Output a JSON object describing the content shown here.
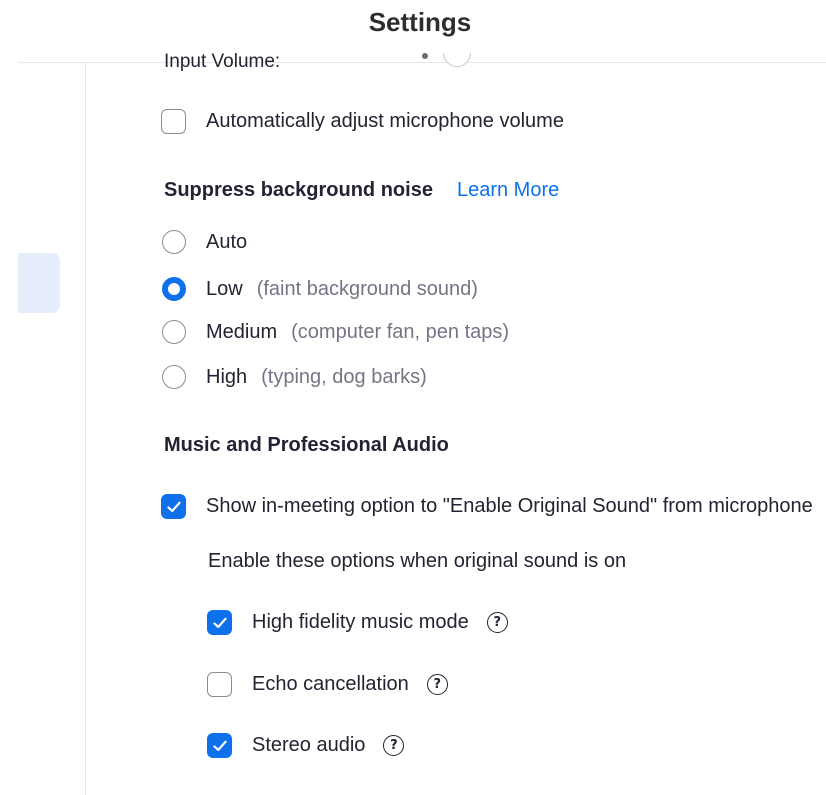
{
  "window": {
    "title": "Settings"
  },
  "audio": {
    "input_volume_label": "Input Volume:",
    "auto_adjust": {
      "label": "Automatically adjust microphone volume",
      "checked": false
    },
    "suppress_noise": {
      "heading": "Suppress background noise",
      "link": "Learn More",
      "selected": "Low",
      "options": [
        {
          "label": "Auto",
          "hint": ""
        },
        {
          "label": "Low",
          "hint": "(faint background sound)"
        },
        {
          "label": "Medium",
          "hint": "(computer fan, pen taps)"
        },
        {
          "label": "High",
          "hint": "(typing, dog barks)"
        }
      ]
    },
    "music": {
      "heading": "Music and Professional Audio",
      "original_sound": {
        "label": "Show in-meeting option to \"Enable Original Sound\" from microphone",
        "checked": true
      },
      "subheading": "Enable these options when original sound is on",
      "options": [
        {
          "label": "High fidelity music mode",
          "checked": true,
          "help_icon": "question-circle-icon"
        },
        {
          "label": "Echo cancellation",
          "checked": false,
          "help_icon": "question-circle-icon"
        },
        {
          "label": "Stereo audio",
          "checked": true,
          "help_icon": "question-circle-icon"
        }
      ]
    }
  },
  "colors": {
    "accent": "#0e71eb",
    "sidebar_selected_bg": "#e5eefa",
    "hint_text": "#747487"
  }
}
